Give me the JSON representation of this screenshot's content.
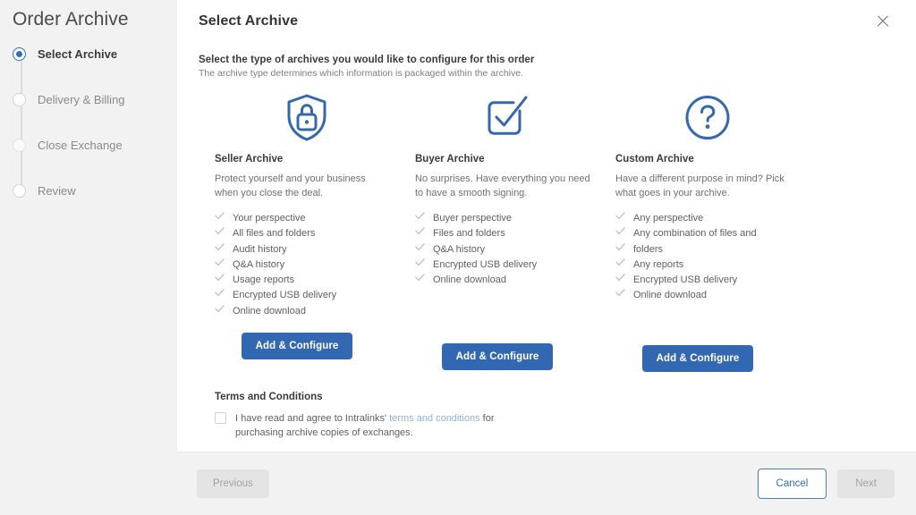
{
  "sidebar": {
    "title": "Order Archive",
    "steps": [
      {
        "label": "Select Archive",
        "state": "active"
      },
      {
        "label": "Delivery & Billing",
        "state": "pending"
      },
      {
        "label": "Close Exchange",
        "state": "muted"
      },
      {
        "label": "Review",
        "state": "pending"
      }
    ]
  },
  "modal": {
    "title": "Select Archive",
    "close_icon": "close-icon",
    "intro_heading": "Select the type of archives you would like to configure for this order",
    "intro_sub": "The archive type determines which information is packaged within the archive."
  },
  "cards": [
    {
      "icon": "shield-lock-icon",
      "title": "Seller Archive",
      "description": "Protect yourself and your business when you close the deal.",
      "features": [
        "Your perspective",
        "All files and folders",
        "Audit history",
        "Q&A history",
        "Usage reports",
        "Encrypted USB delivery",
        "Online download"
      ],
      "button": "Add & Configure"
    },
    {
      "icon": "checkbox-check-icon",
      "title": "Buyer Archive",
      "description": "No surprises. Have everything you need to have a smooth signing.",
      "features": [
        "Buyer perspective",
        "Files and folders",
        "Q&A history",
        "Encrypted USB delivery",
        "Online download"
      ],
      "button": "Add & Configure"
    },
    {
      "icon": "question-circle-icon",
      "title": "Custom Archive",
      "description": "Have a different purpose in mind? Pick what goes in your archive.",
      "features": [
        "Any perspective",
        "Any combination of files and",
        "folders",
        "Any reports",
        "Encrypted USB delivery",
        "Online download"
      ],
      "button": "Add & Configure"
    }
  ],
  "terms": {
    "heading": "Terms and Conditions",
    "text_before": "I have read and agree to Intralinks'",
    "link": "terms and conditions",
    "text_after": "for purchasing archive copies of exchanges.",
    "checked": false
  },
  "footer": {
    "previous_label": "Previous",
    "cancel_label": "Cancel",
    "next_label": "Next"
  },
  "colors": {
    "accent_blue": "#3267b2",
    "icon_blue": "#3568ad",
    "check_green": "#b9cbb3",
    "link_blue": "#8fb0d6",
    "page_bg": "#f2f2f2"
  }
}
